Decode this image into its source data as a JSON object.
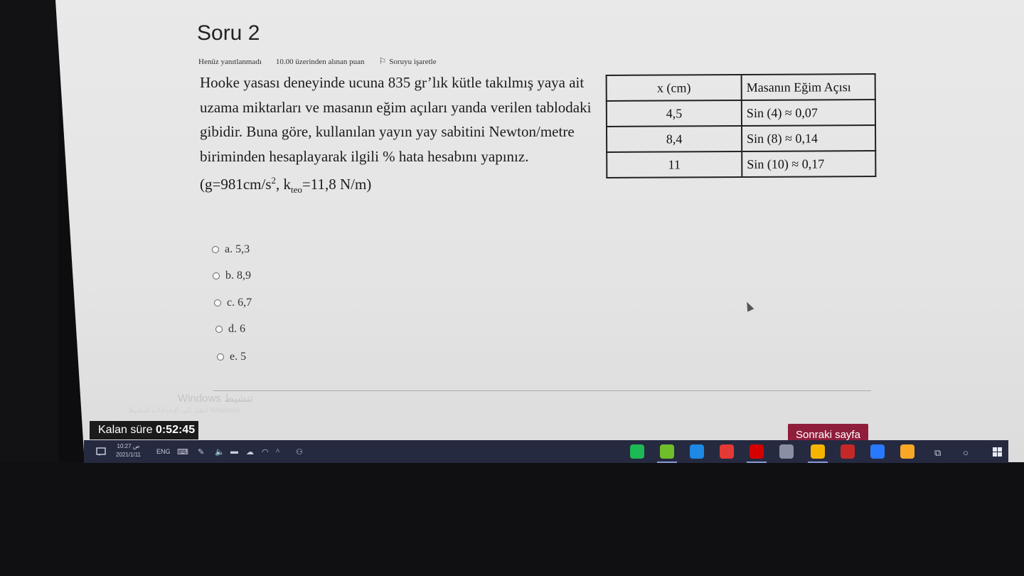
{
  "question": {
    "title": "Soru 2",
    "status": "Henüz yanıtlanmadı",
    "points": "10.00 üzerinden alınan puan",
    "flag_label": "Soruyu işaretle",
    "text": "Hooke yasası deneyinde ucuna 835 gr’lık kütle takılmış yaya ait uzama miktarları ve masanın eğim açıları yanda verilen tablodaki gibidir. Buna göre, kullanılan yayın yay sabitini Newton/metre biriminden hesaplayarak ilgili % hata hesabını yapınız.",
    "formula_prefix": "(g=981cm/s",
    "formula_sup": "2",
    "formula_mid": ", k",
    "formula_sub": "teo",
    "formula_suffix": "=11,8 N/m)"
  },
  "table": {
    "headers": [
      "x (cm)",
      "Masanın Eğim Açısı"
    ],
    "rows": [
      [
        "4,5",
        "Sin (4) ≈ 0,07"
      ],
      [
        "8,4",
        "Sin (8) ≈ 0,14"
      ],
      [
        "11",
        "Sin (10) ≈ 0,17"
      ]
    ]
  },
  "options": [
    {
      "label": "a. 5,3"
    },
    {
      "label": "b. 8,9"
    },
    {
      "label": "c. 6,7"
    },
    {
      "label": "d. 6"
    },
    {
      "label": "e. 5"
    }
  ],
  "watermark": {
    "line1": "Windows تنشيط",
    "line2": "انتقل إلى الإعدادات لتنشيط Windows"
  },
  "timer": {
    "label": "Kalan süre",
    "value": "0:52:45"
  },
  "next_button": "Sonraki sayfa",
  "taskbar": {
    "time": "10:27 ص",
    "date": "2021/1/11",
    "language": "ENG",
    "tray_icons": [
      "keyboard-icon",
      "pen-icon",
      "volume-icon",
      "battery-icon",
      "cloud-icon",
      "wifi-icon",
      "chevron-up-icon",
      "people-icon"
    ],
    "apps": [
      {
        "name": "spotify",
        "color": "#1db954"
      },
      {
        "name": "utorrent",
        "color": "#6fbf2a"
      },
      {
        "name": "edge",
        "color": "#1e88e5"
      },
      {
        "name": "media-player",
        "color": "#e53935"
      },
      {
        "name": "netflix",
        "color": "#d50000"
      },
      {
        "name": "store",
        "color": "#8a8fa3"
      },
      {
        "name": "chrome",
        "color": "#f4b400"
      },
      {
        "name": "magnet-app",
        "color": "#c62828"
      },
      {
        "name": "mail",
        "color": "#2979ff"
      },
      {
        "name": "file-explorer",
        "color": "#f9a825"
      }
    ]
  }
}
